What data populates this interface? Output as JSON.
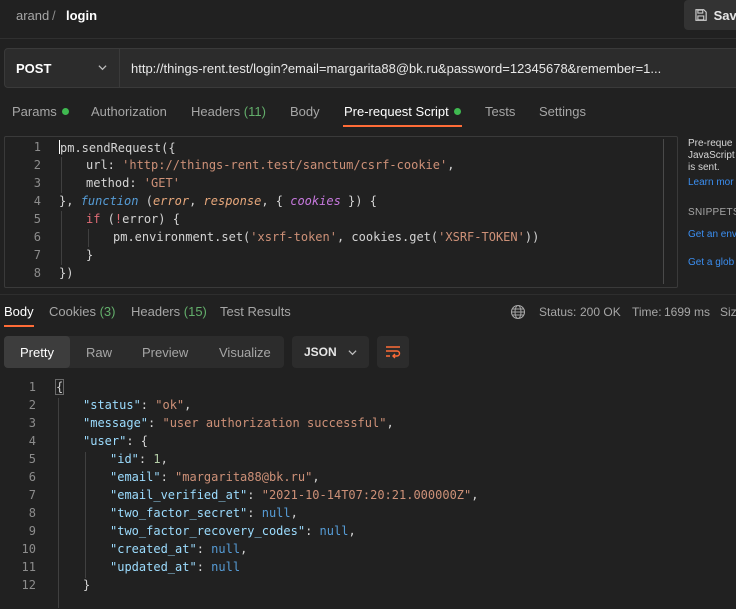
{
  "breadcrumb": {
    "workspace": "arand",
    "separator": "/",
    "request": "login"
  },
  "toolbar": {
    "save_label": "Save"
  },
  "request": {
    "method": "POST",
    "url": "http://things-rent.test/login?email=margarita88@bk.ru&password=12345678&remember=1..."
  },
  "request_tabs": [
    {
      "label": "Params",
      "dot": true
    },
    {
      "label": "Authorization"
    },
    {
      "label": "Headers",
      "count": "(11)"
    },
    {
      "label": "Body"
    },
    {
      "label": "Pre-request Script",
      "dot": true,
      "active": true
    },
    {
      "label": "Tests"
    },
    {
      "label": "Settings"
    }
  ],
  "script": {
    "line_numbers": [
      "1",
      "2",
      "3",
      "4",
      "5",
      "6",
      "7",
      "8"
    ],
    "l1": "pm.sendRequest({",
    "l2_key": "url: ",
    "l2_val": "'http://things-rent.test/sanctum/csrf-cookie'",
    "l2_end": ",",
    "l3_key": "method: ",
    "l3_val": "'GET'",
    "l4_a": "}, ",
    "l4_kw": "function",
    "l4_b": " (",
    "l4_p1": "error",
    "l4_c": ", ",
    "l4_p2": "response",
    "l4_d": ", { ",
    "l4_p3": "cookies",
    "l4_e": " }) {",
    "l5_kw": "if",
    "l5_a": " (",
    "l5_not": "!",
    "l5_b": "error) {",
    "l6_a": "pm.environment.set(",
    "l6_s1": "'xsrf-token'",
    "l6_b": ", cookies.get(",
    "l6_s2": "'XSRF-TOKEN'",
    "l6_c": "))",
    "l7": "}",
    "l8": "})"
  },
  "help_panel": {
    "line1": "Pre-reque",
    "line2": "JavaScript",
    "line3": "is sent.",
    "learn_more": "Learn mor",
    "snippets_title": "SNIPPETS",
    "snippet1": "Get an env",
    "snippet2": "Get a glob"
  },
  "response_tabs": [
    {
      "label": "Body",
      "active": true
    },
    {
      "label": "Cookies",
      "count": "(3)"
    },
    {
      "label": "Headers",
      "count": "(15)"
    },
    {
      "label": "Test Results"
    }
  ],
  "response_status": {
    "status_label": "Status:",
    "status_value": "200 OK",
    "time_label": "Time:",
    "time_value": "1699 ms",
    "size_label": "Siz"
  },
  "view_modes": [
    "Pretty",
    "Raw",
    "Preview",
    "Visualize"
  ],
  "format": "JSON",
  "response_body": {
    "line_numbers": [
      "1",
      "2",
      "3",
      "4",
      "5",
      "6",
      "7",
      "8",
      "9",
      "10",
      "11",
      "12"
    ],
    "open": "{",
    "status_key": "\"status\"",
    "status_val": "\"ok\"",
    "message_key": "\"message\"",
    "message_val": "\"user authorization successful\"",
    "user_key": "\"user\"",
    "id_key": "\"id\"",
    "id_val": "1",
    "email_key": "\"email\"",
    "email_val": "\"margarita88@bk.ru\"",
    "ev_key": "\"email_verified_at\"",
    "ev_val": "\"2021-10-14T07:20:21.000000Z\"",
    "tfs_key": "\"two_factor_secret\"",
    "tfr_key": "\"two_factor_recovery_codes\"",
    "created_key": "\"created_at\"",
    "updated_key": "\"updated_at\"",
    "null_val": "null",
    "close_obj": "}"
  },
  "colors": {
    "accent": "#ff6c37",
    "success": "#3fb950",
    "link": "#3b8ef0"
  },
  "icons": [
    "save-icon",
    "chevron-down-icon",
    "globe-icon",
    "wrap-lines-icon"
  ]
}
